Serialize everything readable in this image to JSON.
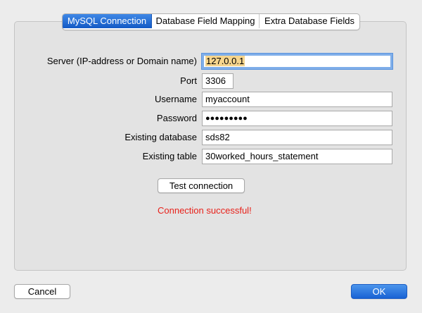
{
  "tabs": [
    {
      "label": "MySQL Connection",
      "active": true
    },
    {
      "label": "Database Field Mapping",
      "active": false
    },
    {
      "label": "Extra Database Fields",
      "active": false
    }
  ],
  "form": {
    "server": {
      "label": "Server (IP-address or Domain name)",
      "value": "127.0.0.1"
    },
    "port": {
      "label": "Port",
      "value": "3306"
    },
    "username": {
      "label": "Username",
      "value": "myaccount"
    },
    "password": {
      "label": "Password",
      "value": "●●●●●●●●●"
    },
    "database": {
      "label": "Existing database",
      "value": "sds82"
    },
    "table": {
      "label": "Existing table",
      "value": "30worked_hours_statement"
    }
  },
  "test_button": {
    "label": "Test connection"
  },
  "status": {
    "text": "Connection successful!",
    "color": "#e8211a"
  },
  "footer": {
    "cancel_label": "Cancel",
    "ok_label": "OK"
  },
  "colors": {
    "accent": "#1a66cf",
    "selection": "#f6d58d",
    "focus_ring": "#7faee9"
  }
}
